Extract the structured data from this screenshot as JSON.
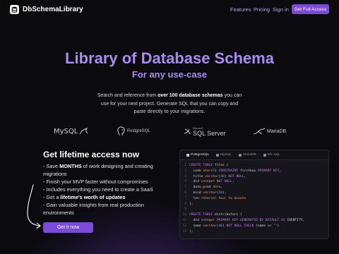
{
  "nav": {
    "brand": "DbSchemaLibrary",
    "links": [
      "Features",
      "Pricing",
      "Sign in"
    ],
    "cta": "Get Full Access"
  },
  "hero": {
    "title": "Library of Database Schema",
    "subtitle": "For any use-case",
    "desc_pre": "Search and reference from ",
    "desc_bold": "over 100 database schemas",
    "desc_post": " you can use for your next project. Generate SQL that you can copy and paste directly to your migrations."
  },
  "logos": [
    {
      "name": "mysql",
      "text": "MySQL"
    },
    {
      "name": "postgresql",
      "text": "PostgreSQL"
    },
    {
      "name": "sql-server",
      "text": "SQL Server",
      "small": "Microsoft"
    },
    {
      "name": "mariadb",
      "text": "MariaDB"
    }
  ],
  "offer": {
    "title": "Get lifetime access now",
    "items": [
      {
        "pre": "- Save ",
        "bold": "MONTHS",
        "post": " of work designing and creating migrations"
      },
      {
        "pre": "- Finish your MVP faster without compromises",
        "bold": "",
        "post": ""
      },
      {
        "pre": "- Includes everything you need to create a SaaS",
        "bold": "",
        "post": ""
      },
      {
        "pre": "- Get a ",
        "bold": "lifetime's worth of updates",
        "post": ""
      },
      {
        "pre": "- Gain valuable insights from real production environments",
        "bold": "",
        "post": ""
      }
    ],
    "cta": "Get it now"
  },
  "code": {
    "tabs": [
      "PostgreSQL",
      "MySQL",
      "MariaDB",
      "MS SQL"
    ],
    "active_tab": 0,
    "lines": [
      [
        [
          "kw",
          "CREATE TABLE"
        ],
        [
          "pl",
          " files ("
        ]
      ],
      [
        [
          "pl",
          "  code "
        ],
        [
          "tp",
          "char"
        ],
        [
          "pl",
          "("
        ],
        [
          "ct",
          "3"
        ],
        [
          "pl",
          ") "
        ],
        [
          "kw",
          "CONSTRAINT"
        ],
        [
          "pl",
          " firstkey "
        ],
        [
          "kw",
          "PRIMARY KEY"
        ],
        [
          "pl",
          ","
        ]
      ],
      [
        [
          "pl",
          "  title "
        ],
        [
          "tp",
          "varchar"
        ],
        [
          "pl",
          "("
        ],
        [
          "ct",
          "40"
        ],
        [
          "pl",
          ") "
        ],
        [
          "kw",
          "NOT NULL"
        ],
        [
          "pl",
          ","
        ]
      ],
      [
        [
          "pl",
          "  did "
        ],
        [
          "tp",
          "integer"
        ],
        [
          "pl",
          " "
        ],
        [
          "kw",
          "NOT NULL"
        ],
        [
          "pl",
          ","
        ]
      ],
      [
        [
          "pl",
          "  date_prod "
        ],
        [
          "tp",
          "date"
        ],
        [
          "pl",
          ","
        ]
      ],
      [
        [
          "pl",
          "  kind "
        ],
        [
          "tp",
          "varchar"
        ],
        [
          "pl",
          "("
        ],
        [
          "ct",
          "10"
        ],
        [
          "pl",
          "),"
        ]
      ],
      [
        [
          "pl",
          "  len "
        ],
        [
          "tp",
          "interval hour to minute"
        ]
      ],
      [
        [
          "pl",
          ");"
        ]
      ],
      [],
      [
        [
          "kw",
          "CREATE TABLE"
        ],
        [
          "pl",
          " distributors ("
        ]
      ],
      [
        [
          "pl",
          "  did "
        ],
        [
          "tp",
          "integer"
        ],
        [
          "pl",
          " "
        ],
        [
          "kw",
          "PRIMARY KEY GENERATED BY DEFAULT AS"
        ],
        [
          "pl",
          " IDENTITY,"
        ]
      ],
      [
        [
          "pl",
          "  name "
        ],
        [
          "tp",
          "varchar"
        ],
        [
          "pl",
          "("
        ],
        [
          "ct",
          "40"
        ],
        [
          "pl",
          ") "
        ],
        [
          "kw",
          "NOT NULL CHECK"
        ],
        [
          "pl",
          " (name <> '')"
        ]
      ],
      [
        [
          "pl",
          ");"
        ]
      ]
    ]
  },
  "colors": {
    "accent": "#7c4ad9",
    "heading": "#a88cf0",
    "background": "#0b0a0f",
    "keyword": "#c47bf0",
    "type": "#e6a06c",
    "number": "#7aa9ec"
  },
  "icons": [
    "database-icon",
    "mysql-dolphin-icon",
    "postgresql-elephant-icon",
    "sql-server-icon",
    "mariadb-seal-icon",
    "arrow-icon",
    "db-tab-icon"
  ]
}
